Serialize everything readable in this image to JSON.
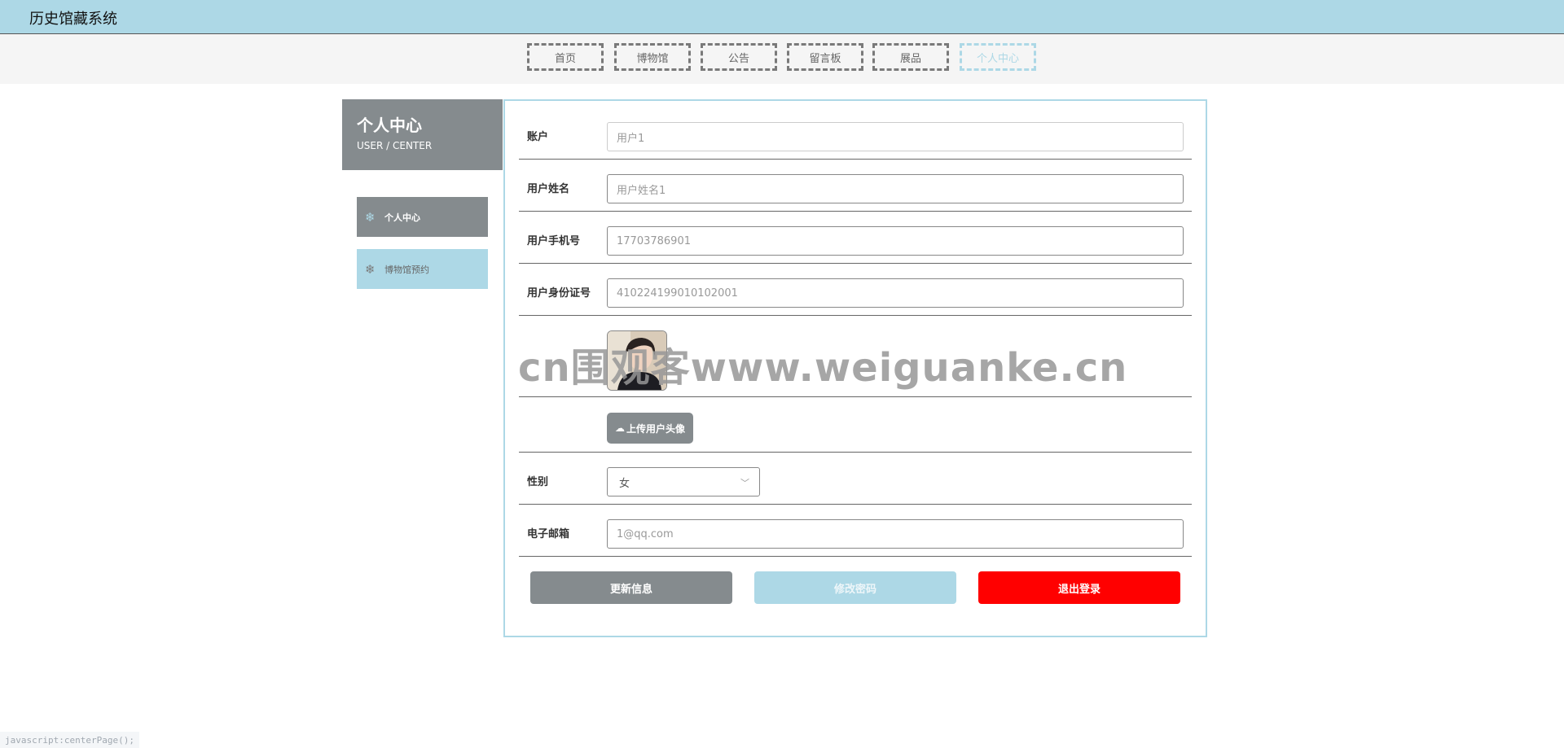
{
  "app": {
    "title": "历史馆藏系统"
  },
  "nav": [
    {
      "label": "首页"
    },
    {
      "label": "博物馆"
    },
    {
      "label": "公告"
    },
    {
      "label": "留言板"
    },
    {
      "label": "展品"
    },
    {
      "label": "个人中心",
      "active": true
    }
  ],
  "sidebar": {
    "heading": "个人中心",
    "subheading": "USER / CENTER",
    "items": [
      {
        "label": "个人中心",
        "icon": "snowflake-icon",
        "active": true
      },
      {
        "label": "博物馆预约",
        "icon": "snowflake-icon"
      }
    ]
  },
  "form": {
    "account": {
      "label": "账户",
      "value": "用户1"
    },
    "name": {
      "label": "用户姓名",
      "value": "用户姓名1"
    },
    "phone": {
      "label": "用户手机号",
      "value": "17703786901"
    },
    "id_card": {
      "label": "用户身份证号",
      "value": "410224199010102001"
    },
    "upload_label": "上传用户头像",
    "gender": {
      "label": "性别",
      "value": "女"
    },
    "email": {
      "label": "电子邮箱",
      "value": "1@qq.com"
    }
  },
  "actions": {
    "update": "更新信息",
    "change_password": "修改密码",
    "logout": "退出登录"
  },
  "watermark": "cn围观客www.weiguanke.cn",
  "status_bar": "javascript:centerPage();",
  "colors": {
    "header_bg": "#add8e6",
    "accent_gray": "#858b8e",
    "accent_blue": "#add8e6",
    "danger": "#ff0000"
  }
}
